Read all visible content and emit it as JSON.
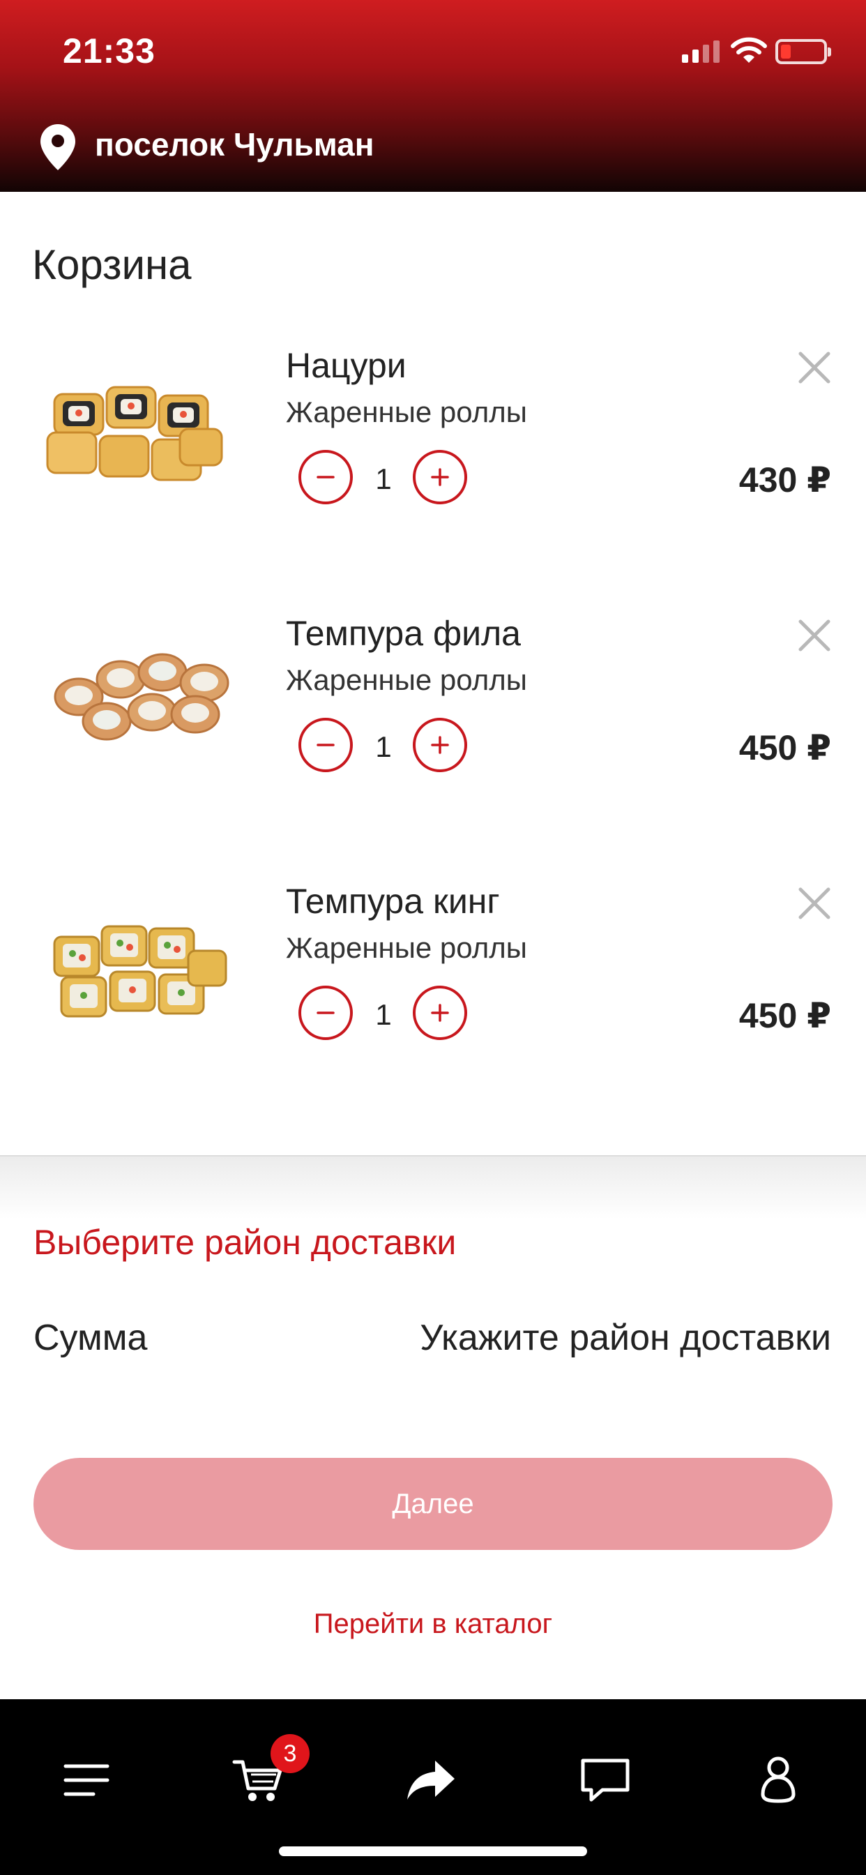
{
  "status_bar": {
    "time": "21:33"
  },
  "location": {
    "text": "поселок Чульман",
    "icon": "map-pin-icon"
  },
  "cart": {
    "title": "Корзина",
    "items": [
      {
        "name": "Нацури",
        "category": "Жаренные роллы",
        "quantity": "1",
        "price": "430 ₽"
      },
      {
        "name": "Темпура фила",
        "category": "Жаренные роллы",
        "quantity": "1",
        "price": "450 ₽"
      },
      {
        "name": "Темпура кинг",
        "category": "Жаренные роллы",
        "quantity": "1",
        "price": "450 ₽"
      }
    ]
  },
  "summary": {
    "delivery_link": "Выберите район доставки",
    "sum_label": "Сумма",
    "sum_value": "Укажите район доставки",
    "next_button": "Далее",
    "catalog_link": "Перейти в каталог"
  },
  "tabbar": {
    "cart_badge": "3",
    "icons": [
      "menu-icon",
      "cart-icon",
      "share-icon",
      "chat-icon",
      "profile-icon"
    ]
  },
  "colors": {
    "accent": "#c8171d",
    "button_disabled": "#ea9ba1",
    "header_top": "#cf1d20",
    "header_bottom": "#120404",
    "tabbar": "#000000"
  }
}
